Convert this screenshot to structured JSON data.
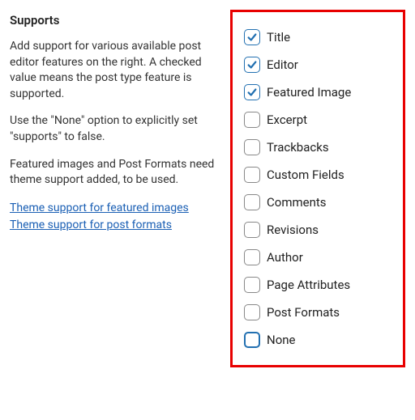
{
  "supports": {
    "heading": "Supports",
    "desc1": "Add support for various available post editor features on the right. A checked value means the post type feature is supported.",
    "desc2": "Use the \"None\" option to explicitly set \"supports\" to false.",
    "desc3": "Featured images and Post Formats need theme support added, to be used.",
    "links": {
      "featured_images": "Theme support for featured images",
      "post_formats": "Theme support for post formats"
    },
    "options": [
      {
        "label": "Title",
        "checked": true,
        "none": false
      },
      {
        "label": "Editor",
        "checked": true,
        "none": false
      },
      {
        "label": "Featured Image",
        "checked": true,
        "none": false
      },
      {
        "label": "Excerpt",
        "checked": false,
        "none": false
      },
      {
        "label": "Trackbacks",
        "checked": false,
        "none": false
      },
      {
        "label": "Custom Fields",
        "checked": false,
        "none": false
      },
      {
        "label": "Comments",
        "checked": false,
        "none": false
      },
      {
        "label": "Revisions",
        "checked": false,
        "none": false
      },
      {
        "label": "Author",
        "checked": false,
        "none": false
      },
      {
        "label": "Page Attributes",
        "checked": false,
        "none": false
      },
      {
        "label": "Post Formats",
        "checked": false,
        "none": false
      },
      {
        "label": "None",
        "checked": false,
        "none": true
      }
    ]
  }
}
